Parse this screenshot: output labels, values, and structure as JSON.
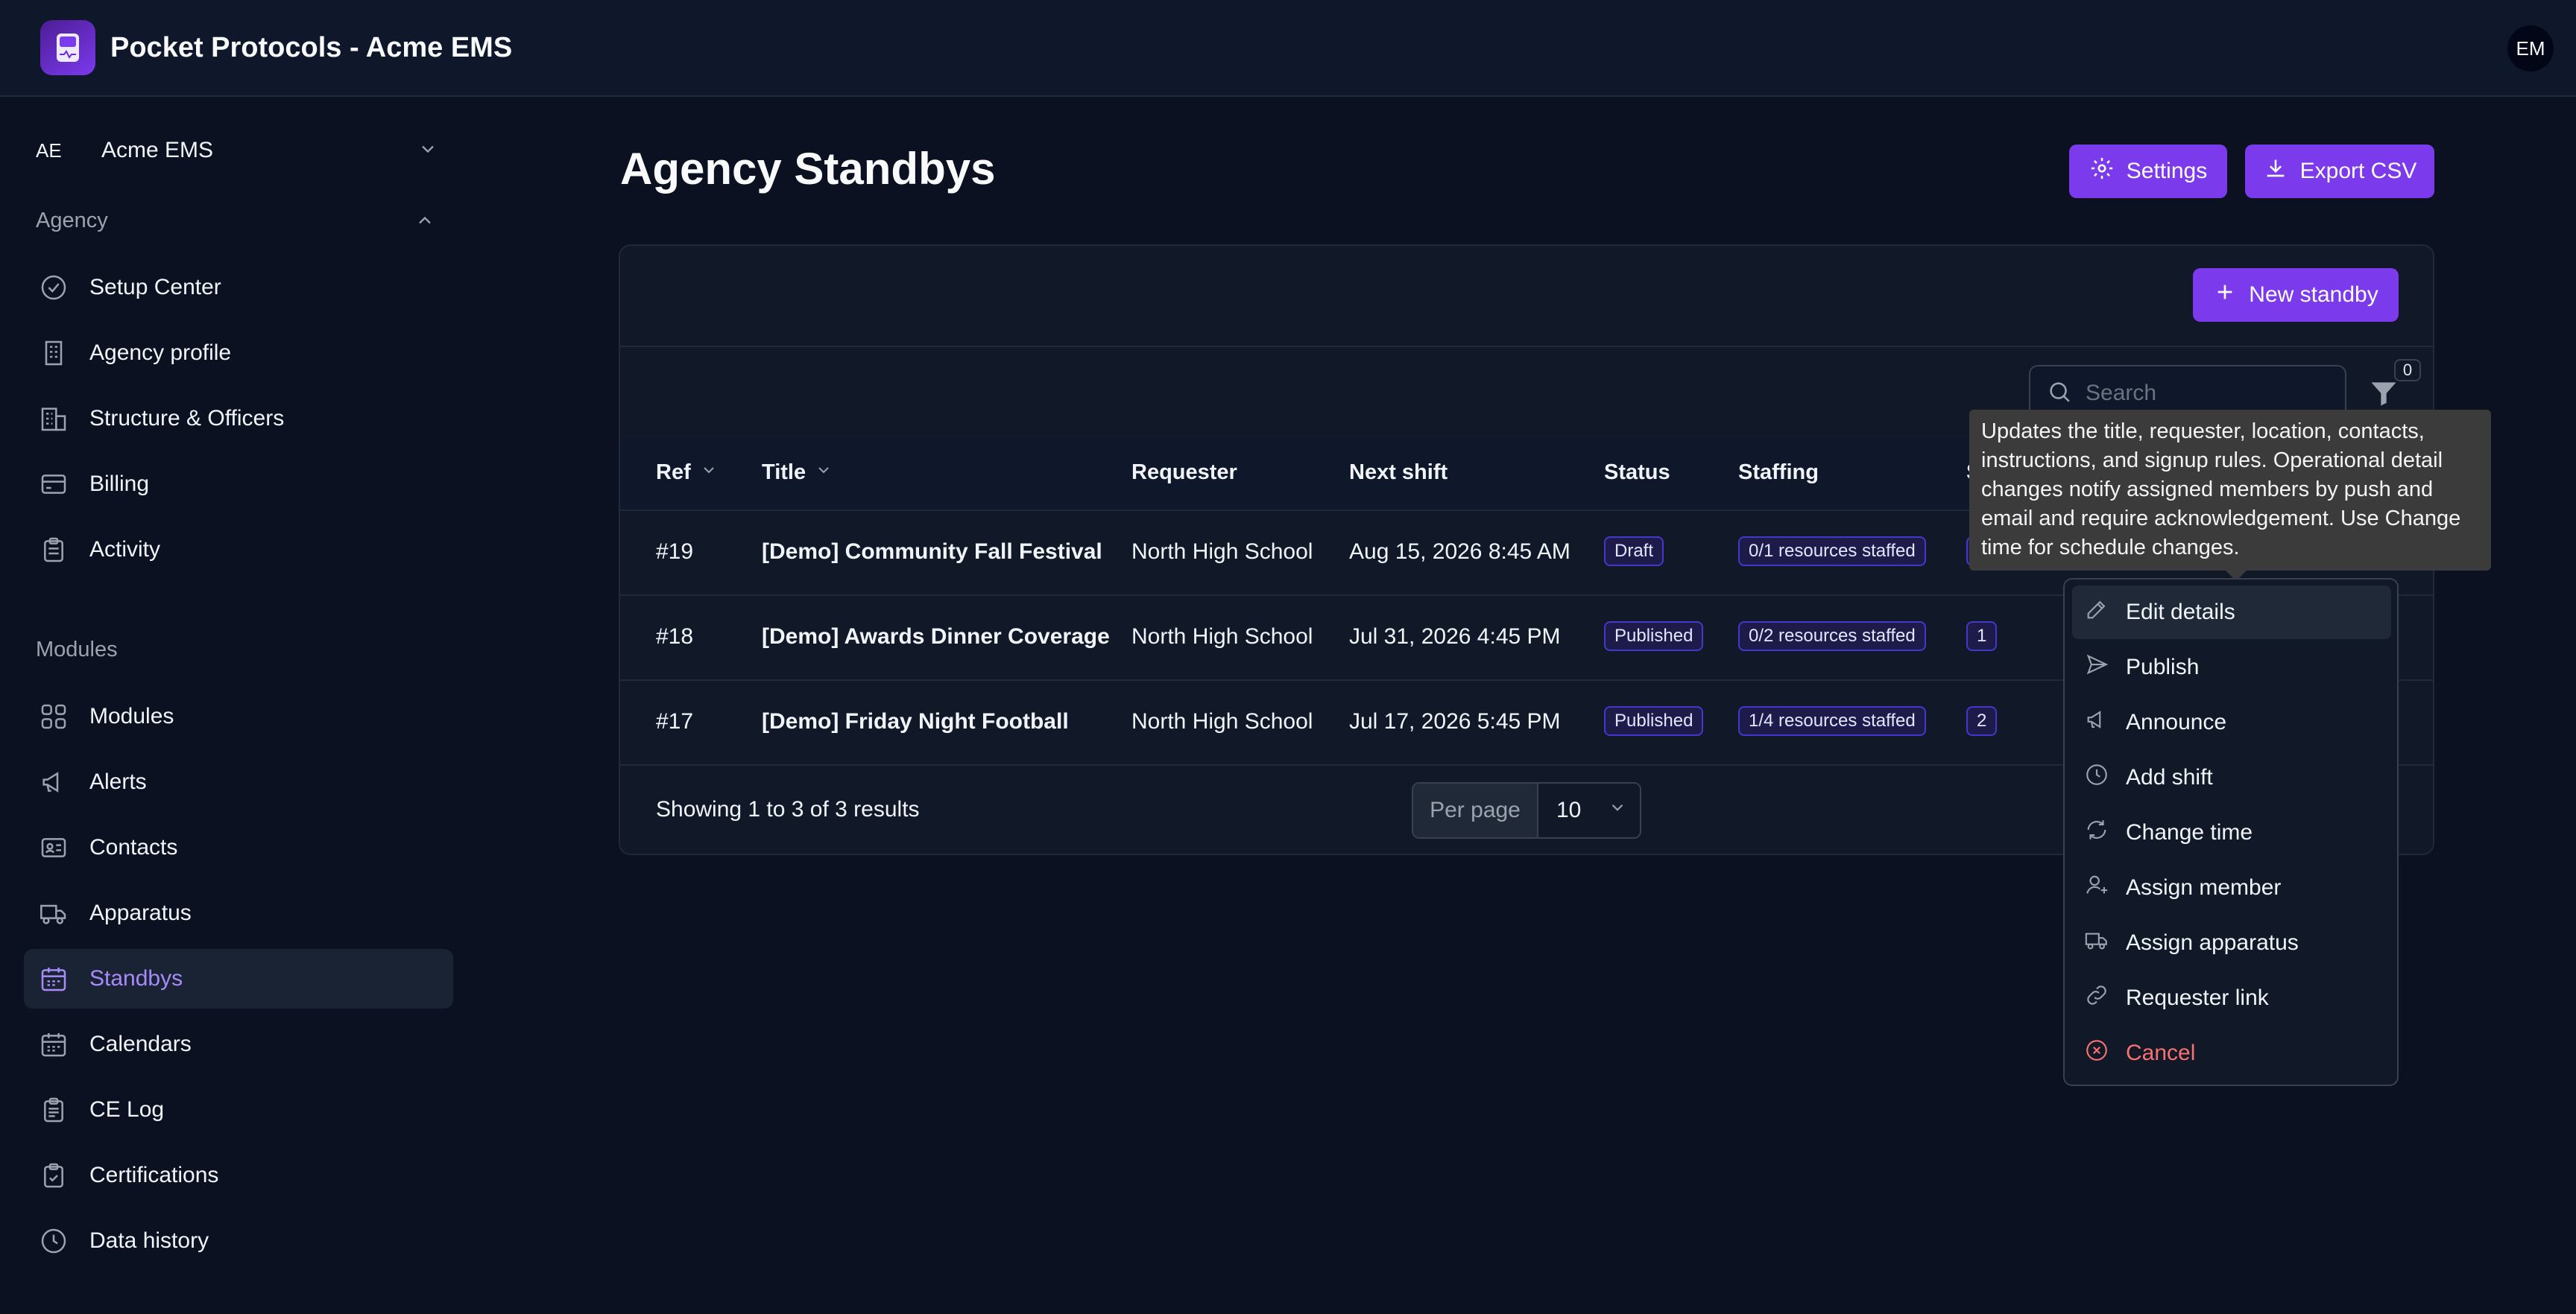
{
  "app": {
    "title": "Pocket Protocols - Acme EMS",
    "user_initials": "EM"
  },
  "sidebar": {
    "org_abbr": "AE",
    "org_name": "Acme EMS",
    "section_agency": "Agency",
    "agency_items": [
      {
        "label": "Setup Center",
        "icon": "check-circle-icon"
      },
      {
        "label": "Agency profile",
        "icon": "building-icon"
      },
      {
        "label": "Structure & Officers",
        "icon": "buildings-icon"
      },
      {
        "label": "Billing",
        "icon": "credit-card-icon"
      },
      {
        "label": "Activity",
        "icon": "clipboard-icon"
      }
    ],
    "section_modules": "Modules",
    "module_items": [
      {
        "label": "Modules",
        "icon": "grid-icon"
      },
      {
        "label": "Alerts",
        "icon": "megaphone-icon"
      },
      {
        "label": "Contacts",
        "icon": "id-card-icon"
      },
      {
        "label": "Apparatus",
        "icon": "truck-icon"
      },
      {
        "label": "Standbys",
        "icon": "calendar-icon",
        "active": true
      },
      {
        "label": "Calendars",
        "icon": "calendar-icon"
      },
      {
        "label": "CE Log",
        "icon": "clipboard-list-icon"
      },
      {
        "label": "Certifications",
        "icon": "clipboard-check-icon"
      },
      {
        "label": "Data history",
        "icon": "clock-icon"
      }
    ]
  },
  "main": {
    "title": "Agency Standbys",
    "settings_label": "Settings",
    "export_label": "Export CSV",
    "new_label": "New standby",
    "search_placeholder": "Search",
    "filter_count": "0",
    "columns": [
      "Ref",
      "Title",
      "Requester",
      "Next shift",
      "Status",
      "Staffing"
    ],
    "rows": [
      {
        "ref": "#19",
        "title": "[Demo] Community Fall Festival",
        "requester": "North High School",
        "next_shift": "Aug 15, 2026 8:45 AM",
        "status": "Draft",
        "staffing": "0/1 resources staffed",
        "count": ""
      },
      {
        "ref": "#18",
        "title": "[Demo] Awards Dinner Coverage",
        "requester": "North High School",
        "next_shift": "Jul 31, 2026 4:45 PM",
        "status": "Published",
        "staffing": "0/2 resources staffed",
        "count": "1"
      },
      {
        "ref": "#17",
        "title": "[Demo] Friday Night Football",
        "requester": "North High School",
        "next_shift": "Jul 17, 2026 5:45 PM",
        "status": "Published",
        "staffing": "1/4 resources staffed",
        "count": "2"
      }
    ],
    "showing": "Showing 1 to 3 of 3 results",
    "per_page_label": "Per page",
    "per_page_value": "10"
  },
  "tooltip": {
    "text": "Updates the title, requester, location, contacts, instructions, and signup rules. Operational detail changes notify assigned members by push and email and require acknowledgement. Use Change time for schedule changes."
  },
  "menu": {
    "items": [
      {
        "label": "Edit details",
        "icon": "pencil-icon"
      },
      {
        "label": "Publish",
        "icon": "send-icon"
      },
      {
        "label": "Announce",
        "icon": "megaphone-icon"
      },
      {
        "label": "Add shift",
        "icon": "clock-icon"
      },
      {
        "label": "Change time",
        "icon": "refresh-icon"
      },
      {
        "label": "Assign member",
        "icon": "user-plus-icon"
      },
      {
        "label": "Assign apparatus",
        "icon": "truck-icon"
      },
      {
        "label": "Requester link",
        "icon": "link-icon"
      },
      {
        "label": "Cancel",
        "icon": "x-circle-icon"
      }
    ]
  },
  "colors": {
    "accent": "#7c3aed",
    "active_text": "#a78bfa",
    "danger": "#f87171"
  }
}
